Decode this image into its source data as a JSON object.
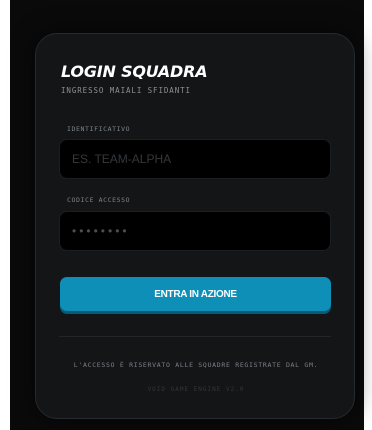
{
  "login": {
    "title": "LOGIN SQUADRA",
    "subtitle": "INGRESSO MAIALI SFIDANTI",
    "id_field": {
      "label": "IDENTIFICATIVO",
      "placeholder": "ES. TEAM-ALPHA",
      "value": ""
    },
    "code_field": {
      "label": "CODICE ACCESSO",
      "placeholder": "••••••••",
      "value": ""
    },
    "submit_label": "ENTRA IN AZIONE",
    "notice": "L'ACCESSO È RISERVATO ALLE SQUADRE REGISTRATE DAL GM.",
    "version": "VOID GAME ENGINE V2.0"
  },
  "colors": {
    "accent": "#0e8fb8",
    "card_background": "#131517",
    "field_background": "#000000",
    "text_primary": "#ffffff",
    "text_muted": "#7f858b"
  }
}
